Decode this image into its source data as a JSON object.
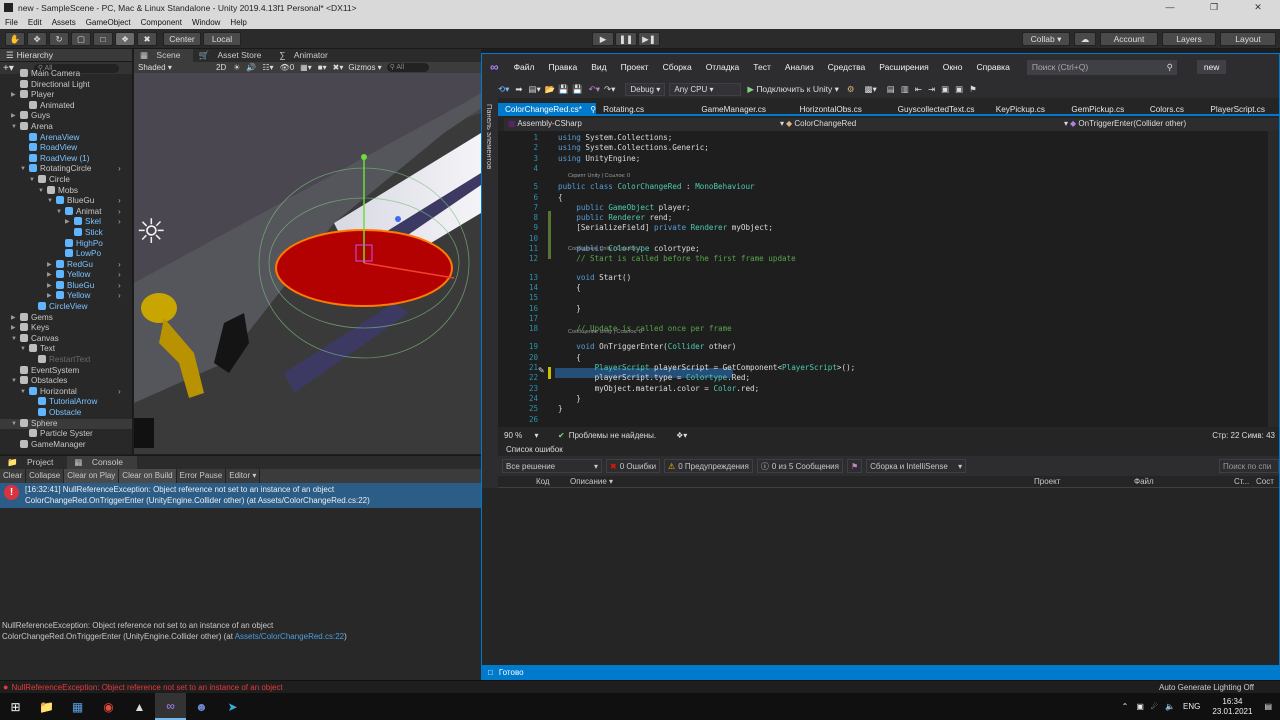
{
  "unity": {
    "title": "new - SampleScene - PC, Mac & Linux Standalone - Unity 2019.4.13f1 Personal* <DX11>",
    "menu": [
      "File",
      "Edit",
      "Assets",
      "GameObject",
      "Component",
      "Window",
      "Help"
    ],
    "toolbar": {
      "center": "Center",
      "local": "Local",
      "collab": "Collab ▾",
      "account": "Account",
      "layers": "Layers",
      "layout": "Layout"
    },
    "hierarchy": {
      "tab": "Hierarchy",
      "search": "All",
      "items": [
        "Main Camera",
        "Directional Light",
        "Player",
        "Animated",
        "Guys",
        "Arena",
        "ArenaView",
        "RoadView",
        "RoadView (1)",
        "RotatingCircle",
        "Circle",
        "Mobs",
        "BlueGu",
        "Animat",
        "Skel",
        "Stick",
        "HighPo",
        "LowPo",
        "RedGu",
        "Yellow",
        "BlueGu",
        "Yellow",
        "CircleView",
        "Gems",
        "Keys",
        "Canvas",
        "Text",
        "RestartText",
        "EventSystem",
        "Obstacles",
        "Horizontal",
        "TutorialArrow",
        "Obstacle",
        "Sphere",
        "Particle Syster",
        "GameManager"
      ]
    },
    "scene": {
      "tabs": [
        "Scene",
        "Asset Store",
        "Animator"
      ],
      "shading": "Shaded",
      "mode2d": "2D",
      "gizmos": "Gizmos",
      "search": "All",
      "layers_count": "0"
    },
    "console": {
      "tabs": [
        "Project",
        "Console"
      ],
      "buttons": [
        "Clear",
        "Collapse",
        "Clear on Play",
        "Clear on Build",
        "Error Pause",
        "Editor ▾"
      ],
      "error_line1": "[16:32:41] NullReferenceException: Object reference not set to an instance of an object",
      "error_line2": "ColorChangeRed.OnTriggerEnter (UnityEngine.Collider other) (at Assets/ColorChangeRed.cs:22)",
      "detail_line1": "NullReferenceException: Object reference not set to an instance of an object",
      "detail_line2": "ColorChangeRed.OnTriggerEnter (UnityEngine.Collider other) (at ",
      "detail_link": "Assets/ColorChangeRed.cs:22",
      "detail_end": ")"
    },
    "status_error": "NullReferenceException: Object reference not set to an instance of an object",
    "status_right": "Auto Generate Lighting Off"
  },
  "vs": {
    "menu": [
      "Файл",
      "Правка",
      "Вид",
      "Проект",
      "Сборка",
      "Отладка",
      "Тест",
      "Анализ",
      "Средства",
      "Расширения",
      "Окно",
      "Справка"
    ],
    "search": "Поиск (Ctrl+Q)",
    "solution": "new",
    "config": "Debug",
    "platform": "Any CPU",
    "run": "Подключить к Unity",
    "side_panel": "Панель элементов",
    "tabs": [
      "ColorChangeRed.cs*",
      "Rotating.cs",
      "GameManager.cs",
      "HorizontalObs.cs",
      "GuyscollectedText.cs",
      "KeyPickup.cs",
      "GemPickup.cs",
      "Colors.cs",
      "PlayerScript.cs"
    ],
    "nav": {
      "project": "Assembly-CSharp",
      "type": "ColorChangeRed",
      "member": "OnTriggerEnter(Collider other)"
    },
    "lens": {
      "script": "Скрипт Unity | Ссылок: 0",
      "msg1": "Сообщение Unity | Ссылок: 0",
      "msg2": "Сообщение Unity | Ссылок: 0"
    },
    "code": [
      "using System.Collections;",
      "using System.Collections.Generic;",
      "using UnityEngine;",
      "",
      "public class ColorChangeRed : MonoBehaviour",
      "{",
      "    public GameObject player;",
      "    public Renderer rend;",
      "    [SerializeField] private Renderer myObject;",
      "",
      "    public Colortype colortype;",
      "    // Start is called before the first frame update",
      "    void Start()",
      "    {",
      "",
      "    }",
      "",
      "    // Update is called once per frame",
      "    void OnTriggerEnter(Collider other)",
      "    {",
      "        PlayerScript playerScript = GetComponent<PlayerScript>();",
      "        playerScript.type = Colortype.Red;",
      "        myObject.material.color = Color.red;",
      "    }",
      "}",
      ""
    ],
    "zoom": "90 %",
    "no_problems": "Проблемы не найдены.",
    "cursor": "Стр: 22   Симв: 43",
    "errlist": {
      "title": "Список ошибок",
      "scope": "Все решение",
      "errors": "0 Ошибки",
      "warnings": "0 Предупреждения",
      "messages": "0 из 5 Сообщения",
      "build": "Сборка и IntelliSense",
      "search": "Поиск по спи",
      "cols": [
        "Код",
        "Описание",
        "Проект",
        "Файл",
        "Ст...",
        "Сост"
      ]
    },
    "status": "Готово"
  },
  "taskbar": {
    "lang": "ENG",
    "time": "16:34",
    "date": "23.01.2021"
  }
}
